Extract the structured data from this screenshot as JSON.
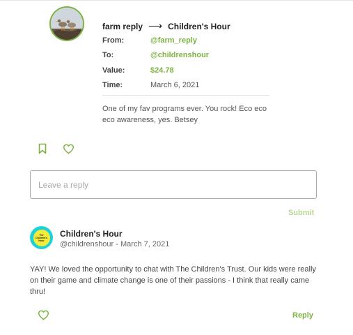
{
  "colors": {
    "accent": "#7cb342",
    "accent_light": "#b5d896"
  },
  "transaction": {
    "sender_name": "farm reply",
    "arrow": "⟶",
    "recipient_name": "Children's Hour",
    "from_label": "From:",
    "from_value": "@farm_reply",
    "to_label": "To:",
    "to_value": "@childrenshour",
    "value_label": "Value:",
    "value_amount": "$24.78",
    "time_label": "Time:",
    "time_value": "March 6, 2021",
    "message": "One of my fav programs ever. You rock! Eco eco eco awareness, yes. Betsey",
    "icons": [
      "bookmark-icon",
      "heart-icon"
    ]
  },
  "reply_form": {
    "placeholder": "Leave a reply",
    "submit_label": "Submit"
  },
  "comment": {
    "author": "Children's Hour",
    "handle": "@childrenshour",
    "separator": " - ",
    "date": "March 7, 2021",
    "avatar_text": "The Children's Hour",
    "body": "YAY! We loved the opportunity to chat with The Children's Trust. Our kids were really on their game and climate change is one of their passions - I think that really came thru!",
    "reply_label": "Reply",
    "icons": [
      "heart-icon"
    ]
  }
}
